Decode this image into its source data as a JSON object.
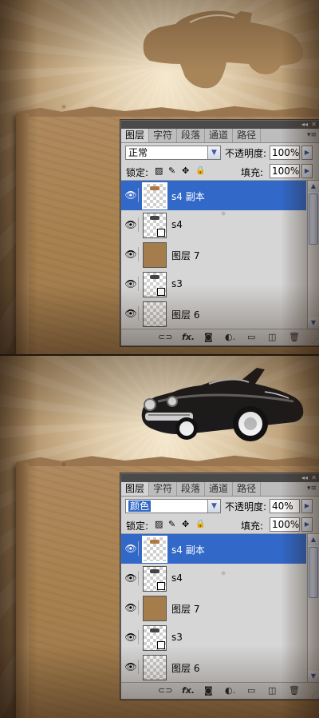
{
  "panel_tabs": [
    "图层",
    "字符",
    "段落",
    "通道",
    "路径"
  ],
  "top": {
    "blend_mode": "正常",
    "opacity_label": "不透明度:",
    "opacity": "100%",
    "lock_label": "锁定:",
    "fill_label": "填充:",
    "fill": "100%",
    "layers": [
      {
        "name": "s4 副本",
        "thumb": "car-copy",
        "selected": true
      },
      {
        "name": "s4",
        "thumb": "car-smart"
      },
      {
        "name": "图层 7",
        "thumb": "solid-brown"
      },
      {
        "name": "s3",
        "thumb": "car-smart"
      },
      {
        "name": "图层 6",
        "thumb": "transparent"
      }
    ]
  },
  "bottom": {
    "blend_mode": "颜色",
    "opacity_label": "不透明度:",
    "opacity": "40%",
    "lock_label": "锁定:",
    "fill_label": "填充:",
    "fill": "100%",
    "layers": [
      {
        "name": "s4 副本",
        "thumb": "car-copy",
        "selected": true
      },
      {
        "name": "s4",
        "thumb": "car-smart"
      },
      {
        "name": "图层 7",
        "thumb": "solid-brown"
      },
      {
        "name": "s3",
        "thumb": "car-smart"
      },
      {
        "name": "图层 6",
        "thumb": "transparent"
      }
    ]
  },
  "icons": {
    "visibility": "eye-icon",
    "lock": [
      "lock-transparent-icon",
      "lock-brush-icon",
      "lock-move-icon",
      "lock-all-icon"
    ],
    "footer": [
      "link-layers-icon",
      "fx-icon",
      "add-mask-icon",
      "adjustment-layer-icon",
      "new-group-icon",
      "new-layer-icon",
      "delete-layer-icon"
    ]
  },
  "glyphs": {
    "collapse": "◂◂",
    "close": "✕",
    "menu": "▾≡",
    "dropdown": "▼",
    "flyout": "▶",
    "eye": "👁",
    "scroll_up": "▲",
    "scroll_down": "▼",
    "lock_transparent": "▨",
    "lock_brush": "✎",
    "lock_move": "✥",
    "lock_all": "🔒",
    "link": "⊂⊃",
    "fx": "fx.",
    "mask": "◙",
    "adjust": "◐.",
    "group": "▭",
    "new": "◫",
    "trash": "🗑",
    "resize": "⋰"
  }
}
